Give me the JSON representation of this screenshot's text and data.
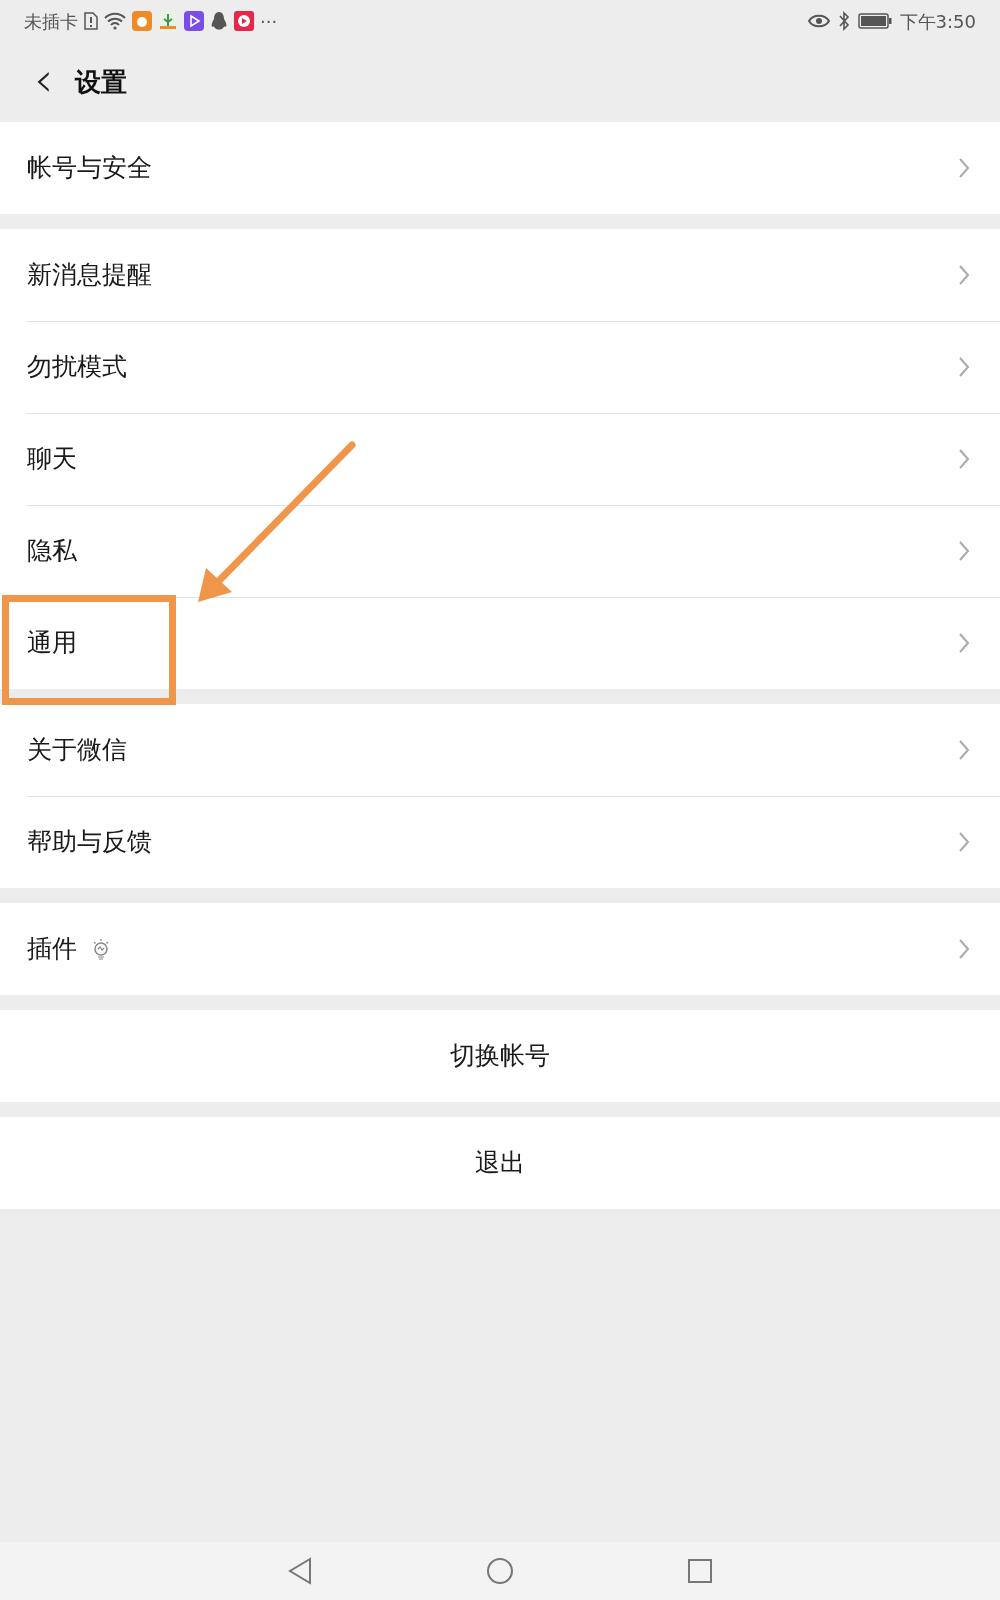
{
  "status_bar": {
    "carrier": "未插卡",
    "overflow": "···",
    "time": "下午3:50"
  },
  "header": {
    "back": "‹",
    "title": "设置"
  },
  "groups": [
    {
      "items": [
        {
          "label": "帐号与安全",
          "kind": "nav",
          "highlighted": false
        }
      ]
    },
    {
      "items": [
        {
          "label": "新消息提醒",
          "kind": "nav",
          "highlighted": false
        },
        {
          "label": "勿扰模式",
          "kind": "nav",
          "highlighted": false
        },
        {
          "label": "聊天",
          "kind": "nav",
          "highlighted": false
        },
        {
          "label": "隐私",
          "kind": "nav",
          "highlighted": false
        },
        {
          "label": "通用",
          "kind": "nav",
          "highlighted": true
        }
      ]
    },
    {
      "items": [
        {
          "label": "关于微信",
          "kind": "nav",
          "highlighted": false
        },
        {
          "label": "帮助与反馈",
          "kind": "nav",
          "highlighted": false
        }
      ]
    },
    {
      "items": [
        {
          "label": "插件",
          "kind": "nav_with_icon",
          "highlighted": false
        }
      ]
    },
    {
      "items": [
        {
          "label": "切换帐号",
          "kind": "action",
          "highlighted": false
        }
      ]
    },
    {
      "items": [
        {
          "label": "退出",
          "kind": "action",
          "highlighted": false
        }
      ]
    }
  ]
}
